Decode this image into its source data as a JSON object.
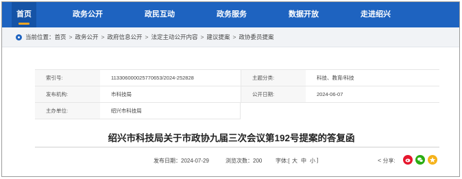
{
  "nav": {
    "items": [
      {
        "label": "首页",
        "active": true
      },
      {
        "label": "政务公开"
      },
      {
        "label": "政民互动"
      },
      {
        "label": "政务服务"
      },
      {
        "label": "数据开放"
      },
      {
        "label": "走进绍兴"
      }
    ]
  },
  "breadcrumb": {
    "prefix": "当前位置：",
    "items": [
      "首页",
      "政务公开",
      "政府信息公开",
      "法定主动公开内容",
      "建议提案",
      "政协委员提案"
    ],
    "separator": ">"
  },
  "info": {
    "index_label": "索引号:",
    "index_value": "113306000025770653/2024-252828",
    "topic_label": "主题分类:",
    "topic_value": "科技、教育/科技",
    "publisher_label": "发布机构:",
    "publisher_value": "市科技局",
    "open_date_label": "公开日期:",
    "open_date_value": "2024-06-07",
    "host_label": "主办单位:",
    "host_value": "绍兴市科技局"
  },
  "article": {
    "title": "绍兴市科技局关于市政协九届三次会议第192号提案的答复函"
  },
  "meta": {
    "publish_date": "发布日期：2024-07-29",
    "views": "浏览次数：200",
    "font_prefix": "字体:[",
    "font_large": "大",
    "font_medium": "中",
    "font_small": "小",
    "font_suffix": "]"
  },
  "share": {
    "label": "分享:",
    "icons": [
      "weibo-icon",
      "wechat-icon",
      "qzone-icon"
    ]
  },
  "colors": {
    "nav_bg": "#1e63c0",
    "nav_active": "#1553a6",
    "accent": "#f5a623"
  }
}
